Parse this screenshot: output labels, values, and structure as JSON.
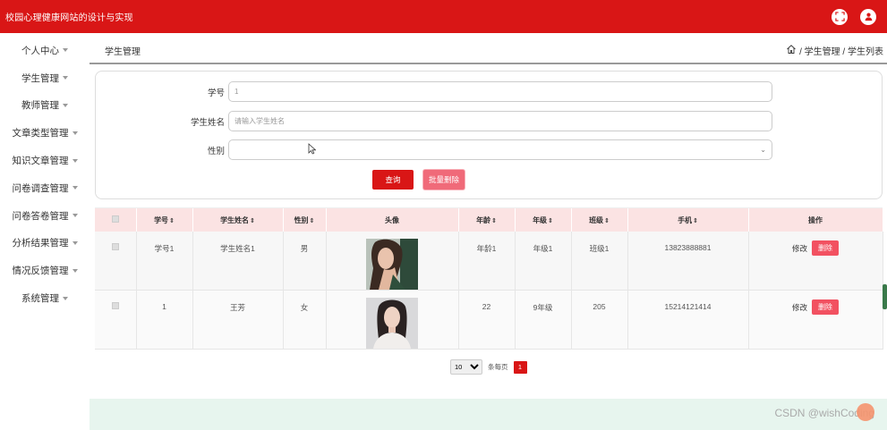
{
  "header": {
    "title": "校园心理健康网站的设计与实现"
  },
  "sidebar": {
    "items": [
      {
        "label": "个人中心"
      },
      {
        "label": "学生管理"
      },
      {
        "label": "教师管理"
      },
      {
        "label": "文章类型管理"
      },
      {
        "label": "知识文章管理"
      },
      {
        "label": "问卷调查管理"
      },
      {
        "label": "问卷答卷管理"
      },
      {
        "label": "分析结果管理"
      },
      {
        "label": "情况反馈管理"
      },
      {
        "label": "系统管理"
      }
    ]
  },
  "crumbbar": {
    "title": "学生管理",
    "path": "/ 学生管理 / 学生列表"
  },
  "search": {
    "student_no_label": "学号",
    "student_no_value": "1",
    "student_name_label": "学生姓名",
    "student_name_placeholder": "请输入学生姓名",
    "gender_label": "性别",
    "gender_value": "",
    "query_button": "查询",
    "batch_delete_button": "批量删除"
  },
  "table": {
    "headers": {
      "student_no": "学号",
      "student_name": "学生姓名",
      "gender": "性别",
      "avatar": "头像",
      "age": "年龄",
      "grade": "年级",
      "class": "班级",
      "phone": "手机",
      "ops": "操作"
    },
    "rows": [
      {
        "student_no": "学号1",
        "student_name": "学生姓名1",
        "gender": "男",
        "age": "年龄1",
        "grade": "年级1",
        "class": "班级1",
        "phone": "13823888881",
        "edit": "修改",
        "delete": "删除"
      },
      {
        "student_no": "1",
        "student_name": "王芳",
        "gender": "女",
        "age": "22",
        "grade": "9年级",
        "class": "205",
        "phone": "15214121414",
        "edit": "修改",
        "delete": "删除"
      }
    ]
  },
  "pagination": {
    "page_size": "10",
    "per_page_label": "条每页",
    "current_page": "1"
  },
  "watermark": "CSDN @wishCoding",
  "colors": {
    "primary": "#d91616",
    "header_row": "#fbe3e3",
    "delete_button": "#f25161",
    "footer": "#e7f5ee"
  }
}
